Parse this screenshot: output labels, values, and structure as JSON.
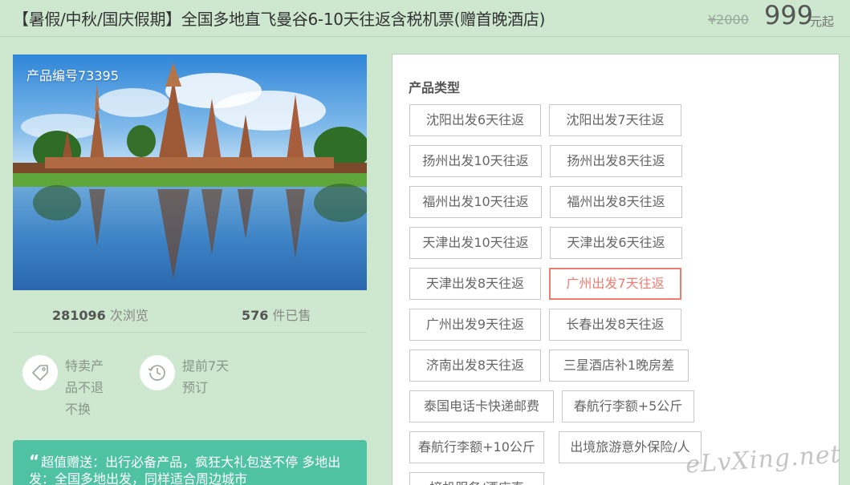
{
  "header": {
    "title": "【暑假/中秋/国庆假期】全国多地直飞曼谷6-10天往返含税机票(赠首晚酒店)",
    "old_price": "¥2000",
    "price": "999",
    "price_unit": "元起"
  },
  "product": {
    "id_label": "产品编号73395",
    "views_count": "281096",
    "views_label": "次浏览",
    "sold_count": "576",
    "sold_label": "件已售"
  },
  "features": [
    {
      "icon": "tag-icon",
      "text": "特卖产品不退不换"
    },
    {
      "icon": "clock-icon",
      "text": "提前7天预订"
    }
  ],
  "gift": {
    "quote": "“",
    "text": "超值赠送：出行必备产品，疯狂大礼包送不停 多地出发：全国多地出发，同样适合周边城市"
  },
  "product_types": {
    "title": "产品类型",
    "options": [
      "沈阳出发6天往返",
      "沈阳出发7天往返",
      "扬州出发10天往返",
      "扬州出发8天往返",
      "福州出发10天往返",
      "福州出发8天往返",
      "天津出发10天往返",
      "天津出发6天往返",
      "天津出发8天往返",
      "广州出发7天往返",
      "广州出发9天往返",
      "长春出发8天往返",
      "济南出发8天往返",
      "三星酒店补1晚房差",
      "泰国电话卡快递邮费",
      "春航行李额+5公斤",
      "春航行李额+10公斤",
      "出境旅游意外保险/人",
      "接机服务/酒店直"
    ],
    "selected": "广州出发7天往返"
  },
  "watermark": "eLvXing.net",
  "colors": {
    "background": "#cde8cf",
    "accent_selected": "#f07c6f",
    "gift_bg": "#4fc2a3"
  }
}
